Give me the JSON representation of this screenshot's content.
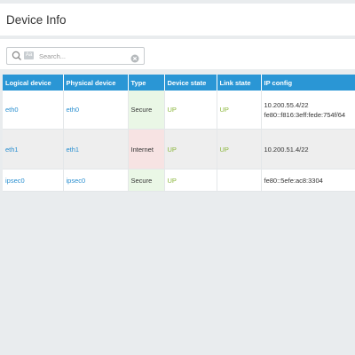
{
  "page": {
    "title": "Device Info"
  },
  "search": {
    "placeholder": "Search...",
    "value": "",
    "case_label": "Aa"
  },
  "table": {
    "headers": {
      "logical": "Logical device",
      "physical": "Physical device",
      "type": "Type",
      "device_state": "Device state",
      "link_state": "Link state",
      "ip_config": "IP config"
    },
    "rows": [
      {
        "logical": "eth0",
        "physical": "eth0",
        "type": "Secure",
        "device_state": "UP",
        "link_state": "UP",
        "ip_config": [
          "10.200.55.4/22",
          "fe80::f816:3eff:fede:754f/64"
        ]
      },
      {
        "logical": "eth1",
        "physical": "eth1",
        "type": "Internet",
        "device_state": "UP",
        "link_state": "UP",
        "ip_config": [
          "10.200.51.4/22"
        ]
      },
      {
        "logical": "ipsec0",
        "physical": "ipsec0",
        "type": "Secure",
        "device_state": "UP",
        "link_state": "",
        "ip_config": [
          "fe80::5efe:ac8:3304"
        ]
      }
    ]
  },
  "colors": {
    "header_bg": "#2a96d5",
    "link": "#2a8fd0",
    "state_up": "#8ab63b",
    "secure_bg": "#eaf7e6",
    "internet_bg": "#f7e3e3",
    "page_bg": "#e9ecee"
  },
  "icons": {
    "search": "search-icon",
    "case": "case-sensitive-icon",
    "clear": "clear-icon"
  }
}
